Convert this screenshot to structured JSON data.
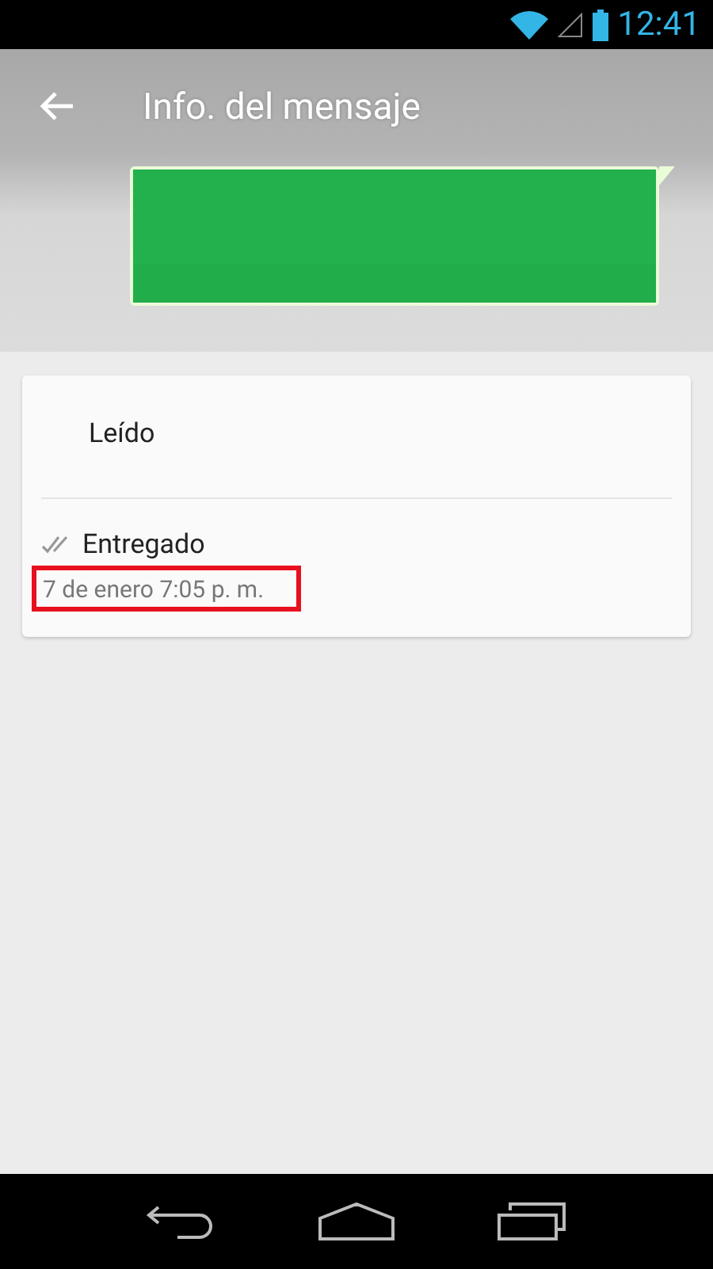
{
  "status_bar": {
    "time": "12:41"
  },
  "app_bar": {
    "title": "Info. del mensaje"
  },
  "receipts": [
    {
      "label": "Leído",
      "kind": "read"
    },
    {
      "label": "Entregado",
      "kind": "delivered",
      "time": "7 de enero 7:05 p. m.",
      "time_highlighted": true
    }
  ]
}
